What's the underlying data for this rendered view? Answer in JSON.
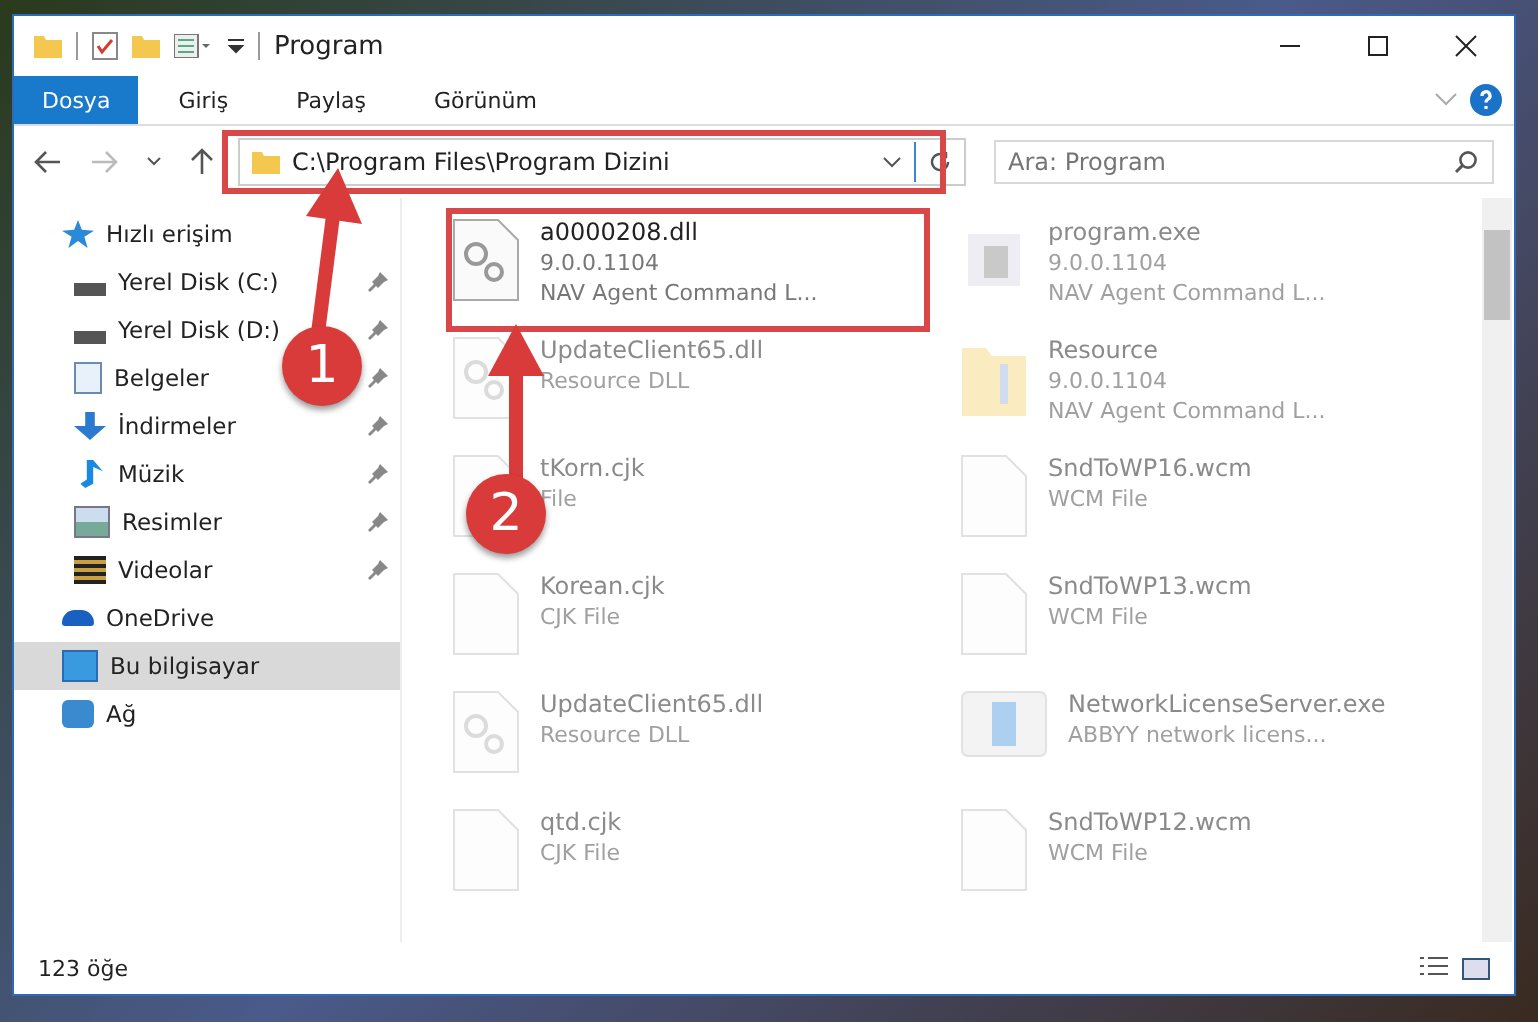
{
  "window": {
    "title": "Program"
  },
  "ribbon_tabs": [
    {
      "label": "Dosya",
      "selected": true
    },
    {
      "label": "Giriş",
      "selected": false
    },
    {
      "label": "Paylaş",
      "selected": false
    },
    {
      "label": "Görünüm",
      "selected": false
    }
  ],
  "address_bar": {
    "path": "C:\\Program Files\\Program Dizini"
  },
  "search": {
    "placeholder": "Ara: Program"
  },
  "sidebar": {
    "items": [
      {
        "label": "Hızlı erişim",
        "kind": "star",
        "selected": false,
        "children": [
          {
            "label": "Yerel Disk (C:)",
            "kind": "drive",
            "pinned": true,
            "selected": false
          },
          {
            "label": "Yerel Disk (D:)",
            "kind": "drive",
            "pinned": true,
            "selected": false
          },
          {
            "label": "Belgeler",
            "kind": "document",
            "pinned": true,
            "selected": false
          },
          {
            "label": "İndirmeler",
            "kind": "download",
            "pinned": true,
            "selected": false
          },
          {
            "label": "Müzik",
            "kind": "music",
            "pinned": true,
            "selected": false
          },
          {
            "label": "Resimler",
            "kind": "picture",
            "pinned": true,
            "selected": false
          },
          {
            "label": "Videolar",
            "kind": "video",
            "pinned": true,
            "selected": false
          }
        ]
      },
      {
        "label": "OneDrive",
        "kind": "cloud",
        "selected": false
      },
      {
        "label": "Bu bilgisayar",
        "kind": "computer",
        "selected": true
      },
      {
        "label": "Ağ",
        "kind": "network",
        "selected": false
      }
    ]
  },
  "files": [
    {
      "name": "a0000208.dll",
      "lines": [
        "9.0.0.1104",
        "NAV Agent Command L..."
      ],
      "kind": "dll",
      "blurred": false
    },
    {
      "name": "program.exe",
      "lines": [
        "9.0.0.1104",
        "NAV Agent Command L..."
      ],
      "kind": "exe",
      "blurred": true
    },
    {
      "name": "UpdateClient65.dll",
      "lines": [
        "Resource DLL"
      ],
      "kind": "dll",
      "blurred": true
    },
    {
      "name": "Resource",
      "lines": [
        "9.0.0.1104",
        "NAV Agent Command L..."
      ],
      "kind": "folder",
      "blurred": true
    },
    {
      "name": "tKorn.cjk",
      "lines": [
        "File"
      ],
      "kind": "file",
      "blurred": true
    },
    {
      "name": "SndToWP16.wcm",
      "lines": [
        "WCM File"
      ],
      "kind": "file",
      "blurred": true
    },
    {
      "name": "Korean.cjk",
      "lines": [
        "CJK File"
      ],
      "kind": "file",
      "blurred": true
    },
    {
      "name": "SndToWP13.wcm",
      "lines": [
        "WCM File"
      ],
      "kind": "file",
      "blurred": true
    },
    {
      "name": "UpdateClient65.dll",
      "lines": [
        "Resource DLL"
      ],
      "kind": "dll",
      "blurred": true
    },
    {
      "name": "NetworkLicenseServer.exe",
      "lines": [
        "ABBYY network licens..."
      ],
      "kind": "app",
      "blurred": true
    },
    {
      "name": "qtd.cjk",
      "lines": [
        "CJK File"
      ],
      "kind": "file",
      "blurred": true
    },
    {
      "name": "SndToWP12.wcm",
      "lines": [
        "WCM File"
      ],
      "kind": "file",
      "blurred": true
    }
  ],
  "status_bar": {
    "item_count": "123 öğe"
  },
  "annotations": [
    {
      "number": "1"
    },
    {
      "number": "2"
    }
  ]
}
